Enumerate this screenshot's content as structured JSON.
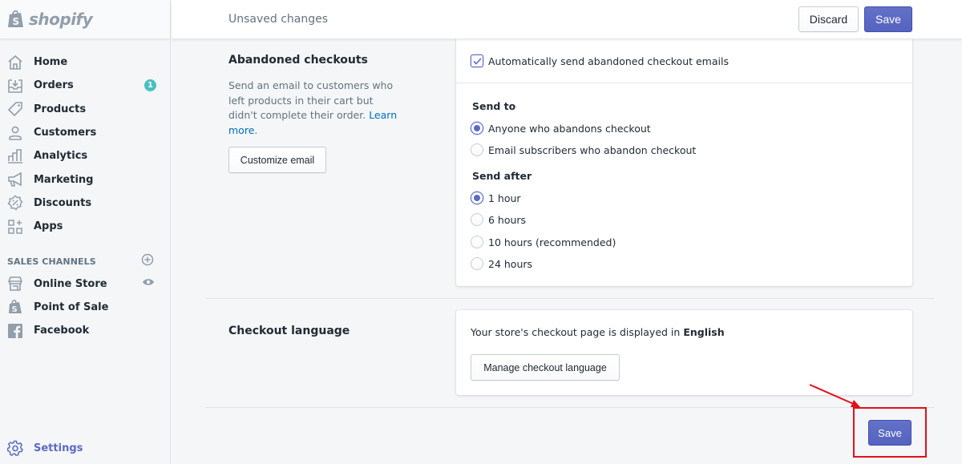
{
  "brand": {
    "name": "shopify",
    "logo_icon": "shopify-bag-icon"
  },
  "sidebar": {
    "items": [
      {
        "label": "Home",
        "icon": "home-icon"
      },
      {
        "label": "Orders",
        "icon": "orders-icon",
        "badge": "1"
      },
      {
        "label": "Products",
        "icon": "tag-icon"
      },
      {
        "label": "Customers",
        "icon": "person-icon"
      },
      {
        "label": "Analytics",
        "icon": "bar-chart-icon"
      },
      {
        "label": "Marketing",
        "icon": "megaphone-icon"
      },
      {
        "label": "Discounts",
        "icon": "discount-icon"
      },
      {
        "label": "Apps",
        "icon": "apps-icon"
      }
    ],
    "sales_channels": {
      "title": "SALES CHANNELS",
      "add_icon": "plus-circle-icon",
      "items": [
        {
          "label": "Online Store",
          "icon": "store-icon",
          "trail_icon": "eye-icon"
        },
        {
          "label": "Point of Sale",
          "icon": "shopify-bag-icon"
        },
        {
          "label": "Facebook",
          "icon": "facebook-icon"
        }
      ]
    },
    "settings": {
      "label": "Settings",
      "icon": "gear-icon"
    }
  },
  "topbar": {
    "title": "Unsaved changes",
    "discard_label": "Discard",
    "save_label": "Save"
  },
  "abandoned_checkouts": {
    "title": "Abandoned checkouts",
    "description": "Send an email to customers who left products in their cart but didn't complete their order.",
    "learn_more": "Learn more",
    "customize_button": "Customize email",
    "auto_send": {
      "label": "Automatically send abandoned checkout emails",
      "checked": true
    },
    "send_to": {
      "title": "Send to",
      "options": [
        {
          "label": "Anyone who abandons checkout",
          "checked": true
        },
        {
          "label": "Email subscribers who abandon checkout",
          "checked": false
        }
      ]
    },
    "send_after": {
      "title": "Send after",
      "options": [
        {
          "label": "1 hour",
          "checked": true
        },
        {
          "label": "6 hours",
          "checked": false
        },
        {
          "label": "10 hours (recommended)",
          "checked": false
        },
        {
          "label": "24 hours",
          "checked": false
        }
      ]
    }
  },
  "checkout_language": {
    "title": "Checkout language",
    "description_prefix": "Your store's checkout page is displayed in",
    "language": "English",
    "manage_button": "Manage checkout language"
  },
  "footer": {
    "save_label": "Save"
  },
  "annotation": {
    "color": "#e3101c"
  },
  "colors": {
    "accent": "#5c6ac4",
    "badge": "#47c1bf",
    "link": "#006fbb"
  }
}
